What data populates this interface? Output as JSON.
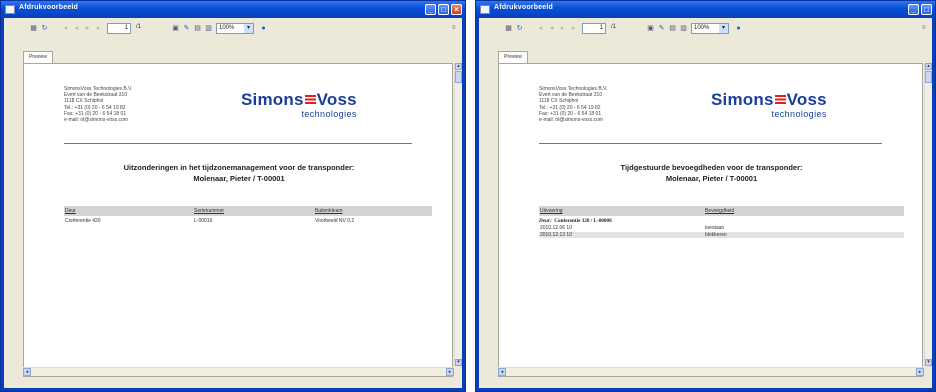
{
  "window_title": "Afdrukvoorbeeld",
  "toolbar": {
    "page_current": "1",
    "page_total": "/1",
    "zoom": "100%"
  },
  "tab_label": "Preview",
  "company": {
    "address_lines": [
      "SimonsVoss Technologies B.V.",
      "Evert van de Beekstraat 310",
      "1118 CX Schiphol",
      "Tel.: +31 (0) 20 - 6 54 19 82",
      "Fax: +31 (0) 20 - 6 54 18 01",
      "e-mail: nl@simons-voss.com"
    ],
    "logo_left": "Simons",
    "logo_right": "Voss",
    "logo_sub": "technologies"
  },
  "report1": {
    "title_line1": "Uitzonderingen in het tijdzonemanagement voor de transponder:",
    "title_line2": "Molenaar, Pieter / T-00001",
    "columns": [
      "Deur",
      "Serienummer",
      "Buitenkleam"
    ],
    "rows": [
      [
        "Conferentie 420",
        "L-00016",
        "Voorbeeld NV 0.2"
      ]
    ]
  },
  "report2": {
    "title_line1": "Tijdgestuurde bevoegdheden voor de transponder:",
    "title_line2": "Molenaar, Pieter / T-00001",
    "columns": [
      "Uitvoering",
      "Bevoegdheid"
    ],
    "group_label": "Deur:",
    "group_value": "Conferentie 320 / L-00008",
    "rows": [
      [
        "2010.12.06 10",
        "toestaan"
      ],
      [
        "2010.12.13 10",
        "blokkeren"
      ]
    ]
  }
}
